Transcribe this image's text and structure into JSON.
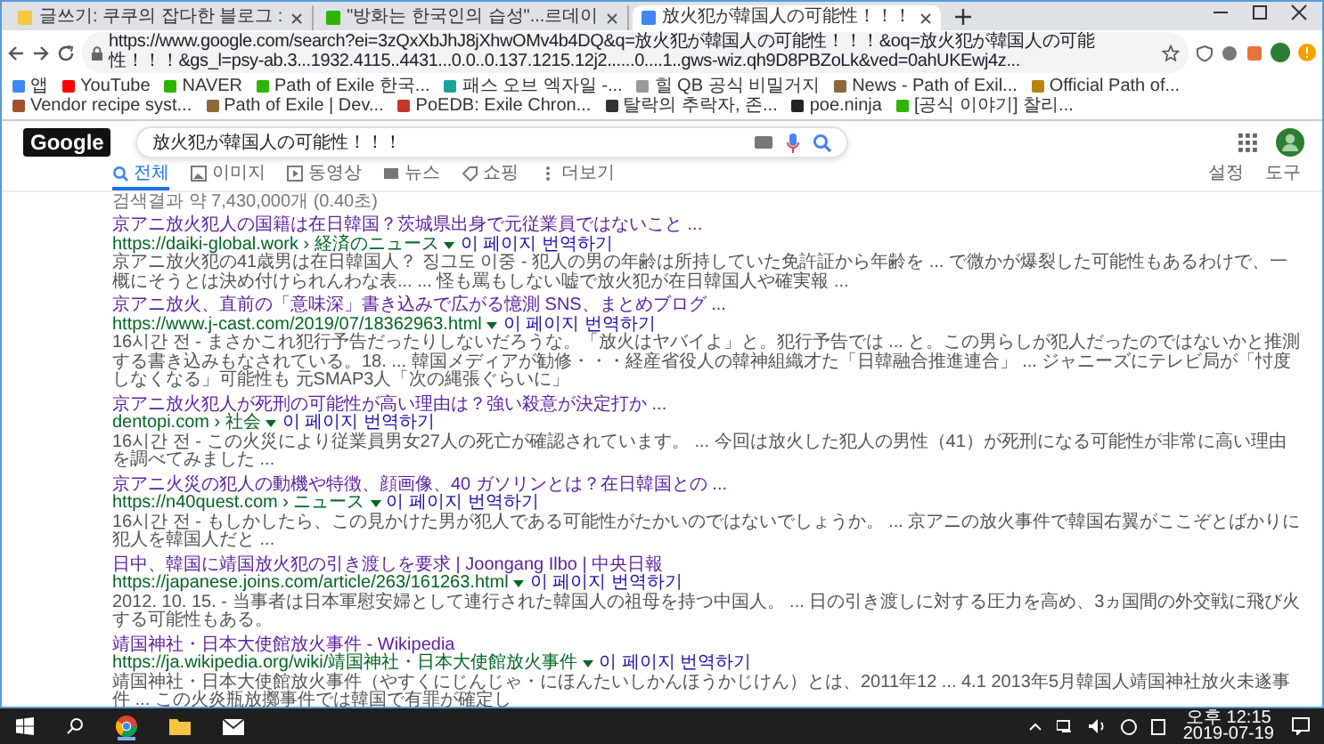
{
  "browser": {
    "tabs": [
      {
        "title": "글쓰기: 쿠쿠의 잡다한 블로그 :",
        "selected": false,
        "color": "#f2c744"
      },
      {
        "title": "\"방화는 한국인의 습성\"...르데이",
        "selected": false,
        "color": "#2db400"
      },
      {
        "title": "放火犯が韓国人の可能性！！！",
        "selected": true,
        "color": "#4285f4"
      }
    ],
    "address": "https://www.google.com/search?ei=3zQxXbJhJ8jXhwOMv4b4DQ&q=放火犯が韓国人の可能性！！！&oq=放火犯が韓国人の可能性！！！&gs_l=psy-ab.3...1932.4115..4431...0.0..0.137.1215.12j2......0....1..gws-wiz.qh9D8PBZoLk&ved=0ahUKEwj4z...",
    "bookmarks": [
      {
        "label": "앱",
        "color": "#4285f4"
      },
      {
        "label": "YouTube",
        "color": "#ff0000"
      },
      {
        "label": "NAVER",
        "color": "#2db400"
      },
      {
        "label": "Path of Exile 한국...",
        "color": "#2db400"
      },
      {
        "label": "패스 오브 엑자일 -...",
        "color": "#1aa39a"
      },
      {
        "label": "힐 QB 공식 비밀거지",
        "color": "#999999"
      },
      {
        "label": "News - Path of Exil...",
        "color": "#8a6a3a"
      },
      {
        "label": "Official Path of...",
        "color": "#b8860b"
      },
      {
        "label": "Vendor recipe syst...",
        "color": "#a0522d"
      },
      {
        "label": "Path of Exile | Dev...",
        "color": "#8a6a3a"
      },
      {
        "label": "PoEDB: Exile Chron...",
        "color": "#c0392b"
      },
      {
        "label": "탈락의 추락자, 존...",
        "color": "#333333"
      },
      {
        "label": "poe.ninja",
        "color": "#222222"
      },
      {
        "label": "[공식 이야기] 찰리...",
        "color": "#2db400"
      }
    ]
  },
  "search": {
    "logo": "Google",
    "query": "放火犯が韓国人の可能性！！！"
  },
  "nav": [
    {
      "label": "전체",
      "selected": true,
      "kind": "search"
    },
    {
      "label": "이미지",
      "selected": false,
      "kind": "image"
    },
    {
      "label": "동영상",
      "selected": false,
      "kind": "video"
    },
    {
      "label": "뉴스",
      "selected": false,
      "kind": "news"
    },
    {
      "label": "쇼핑",
      "selected": false,
      "kind": "shopping"
    },
    {
      "label": "더보기",
      "selected": false,
      "kind": "more"
    }
  ],
  "tools": [
    "설정",
    "도구"
  ],
  "stats": "검색결과 약 7,430,000개 (0.40초)",
  "results": [
    {
      "title": "京アニ放火犯人の国籍は在日韓国？茨城県出身で元従業員ではないこと ...",
      "url": "https://daiki-global.work › 経済のニュース",
      "translate": "이 페이지 번역하기",
      "snippet": "京アニ放火犯の41歳男は在日韓国人？ 징그도 이중 - 犯人の男の年齢は所持していた免許証から年齢を ... で微かが爆裂した可能性もあるわけで、一概にそうとは決め付けられんわな表... ... 怪も罵もしない嘘で放火犯が在日韓国人や確実報 ..."
    },
    {
      "title": "京アニ放火、直前の「意味深」書き込みで広がる憶測 SNS、まとめブログ ...",
      "url": "https://www.j-cast.com/2019/07/18362963.html",
      "translate": "이 페이지 번역하기",
      "snippet": "16시간 전 - まさかこれ犯行予告だったりしないだろうな。「放火はヤバイよ」と。犯行予告では ... と。この男らしが犯人だったのではないかと推測する書き込みもなされている。18. ... 韓国メディアが勧修・・・経産省役人の韓神組織才た「日韓融合推進連合」 ... ジャニーズにテレビ局が「忖度しなくなる」可能性も 元SMAP3人「次の縄張ぐらいに」"
    },
    {
      "title": "京アニ放火犯人が死刑の可能性が高い理由は？強い殺意が決定打か ...",
      "url": "dentopi.com › 社会",
      "translate": "이 페이지 번역하기",
      "snippet": "16시간 전 - この火災により従業員男女27人の死亡が確認されています。 ... 今回は放火した犯人の男性（41）が死刑になる可能性が非常に高い理由を調べてみました ..."
    },
    {
      "title": "京アニ火災の犯人の動機や特徴、顔画像、40 ガソリンとは？在日韓国との ...",
      "url": "https://n40quest.com › ニュース",
      "translate": "이 페이지 번역하기",
      "snippet": "16시간 전 - もしかしたら、この見かけた男が犯人である可能性がたかいのではないでしょうか。 ... 京アニの放火事件で韓国右翼がここぞとばかりに犯人を韓国人だと ..."
    },
    {
      "title": "日中、韓国に靖国放火犯の引き渡しを要求 | Joongang Ilbo | 中央日報",
      "url": "https://japanese.joins.com/article/263/161263.html",
      "translate": "이 페이지 번역하기",
      "snippet": "2012. 10. 15. - 当事者は日本軍慰安婦として連行された韓国人の祖母を持つ中国人。 ... 日の引き渡しに対する圧力を高め、3ヵ国間の外交戦に飛び火する可能性もある。"
    },
    {
      "title": "靖国神社・日本大使館放火事件 - Wikipedia",
      "url": "https://ja.wikipedia.org/wiki/靖国神社・日本大使館放火事件",
      "translate": "이 페이지 번역하기",
      "snippet": "靖国神社・日本大使館放火事件（やすくにじんじゃ・にほんたいしかんほうかじけん）とは、2011年12 ... 4.1 2013年5月韓国人靖国神社放火未遂事件 ... この火炎瓶放擲事件では韓国で有罪が確定し"
    }
  ],
  "taskbar": {
    "time": "오후 12:15",
    "date": "2019-07-19"
  }
}
